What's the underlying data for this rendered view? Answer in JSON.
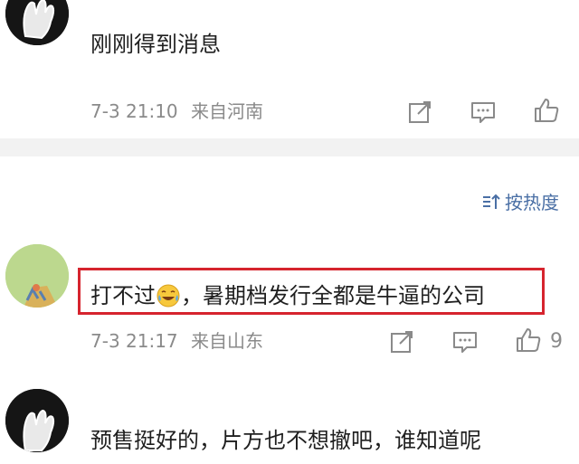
{
  "comments": [
    {
      "text": "刚刚得到消息",
      "date": "7-3 21:10",
      "location": "来自河南",
      "likes": ""
    },
    {
      "text_before": "打不过",
      "text_after": "，暑期档发行全都是牛逼的公司",
      "date": "7-3 21:17",
      "location": "来自山东",
      "likes": "9"
    },
    {
      "text": "预售挺好的，片方也不想撤吧，谁知道呢"
    }
  ],
  "sort": {
    "label": "按热度",
    "icon": "sort-icon"
  },
  "colors": {
    "highlight": "#d6242e",
    "link": "#4a6fa5",
    "meta": "#8a8a8a"
  }
}
